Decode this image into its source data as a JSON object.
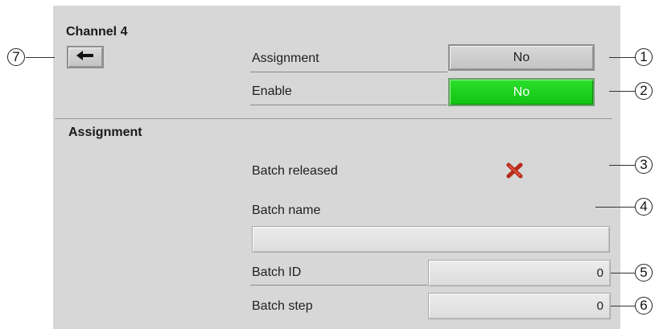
{
  "channel_title": "Channel 4",
  "back_icon": "arrow-left-icon",
  "assignment_row": {
    "label": "Assignment",
    "value": "No"
  },
  "enable_row": {
    "label": "Enable",
    "value": "No",
    "value_color": "#14cc14"
  },
  "section_title": "Assignment",
  "batch_released": {
    "label": "Batch released",
    "status_icon": "red-x-icon",
    "status_color": "#c0392b"
  },
  "batch_name": {
    "label": "Batch name",
    "value": ""
  },
  "batch_id": {
    "label": "Batch ID",
    "value": "0"
  },
  "batch_step": {
    "label": "Batch step",
    "value": "0"
  },
  "callouts": [
    "1",
    "2",
    "3",
    "4",
    "5",
    "6",
    "7"
  ]
}
